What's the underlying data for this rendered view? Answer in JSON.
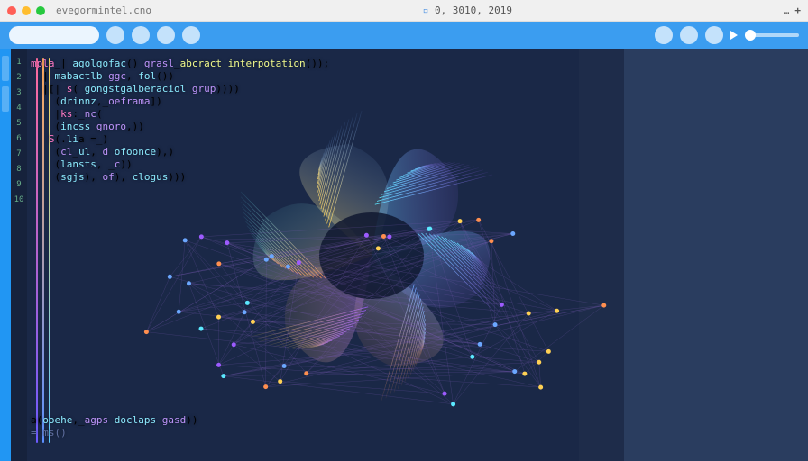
{
  "titlebar": {
    "address_text": "evegormintel.cno",
    "center_text": "0, 3010, 2019",
    "more_label": "…",
    "plus_label": "+"
  },
  "toolbar": {
    "buttons": [
      "menu",
      "search",
      "refresh",
      "settings"
    ],
    "right": [
      "help",
      "history",
      "bookmark",
      "play"
    ]
  },
  "code": {
    "lines": [
      {
        "n": "1",
        "tokens": [
          {
            "c": "kw",
            "t": "mpla"
          },
          {
            "c": "",
            "t": "_| "
          },
          {
            "c": "fn",
            "t": "agolgofac"
          },
          {
            "c": "",
            "t": "() "
          },
          {
            "c": "id",
            "t": "grasl"
          },
          {
            "c": "",
            "t": "_"
          },
          {
            "c": "str",
            "t": "abcract interpotation"
          },
          {
            "c": "",
            "t": "());"
          }
        ]
      },
      {
        "n": "2",
        "tokens": [
          {
            "c": "",
            "t": "  | "
          },
          {
            "c": "fn",
            "t": "mabactlb"
          },
          {
            "c": "",
            "t": " "
          },
          {
            "c": "id",
            "t": "ggc"
          },
          {
            "c": "",
            "t": ", "
          },
          {
            "c": "fn",
            "t": "fol"
          },
          {
            "c": "",
            "t": "())"
          }
        ]
      },
      {
        "n": "3",
        "tokens": [
          {
            "c": "",
            "t": "  |[| "
          },
          {
            "c": "kw",
            "t": "s"
          },
          {
            "c": "",
            "t": "( "
          },
          {
            "c": "fn",
            "t": "gongstgalberaciol"
          },
          {
            "c": "",
            "t": " "
          },
          {
            "c": "id",
            "t": "grup"
          },
          {
            "c": "",
            "t": "))))"
          }
        ]
      },
      {
        "n": "4",
        "tokens": [
          {
            "c": "",
            "t": "    ("
          },
          {
            "c": "fn",
            "t": "drinnz"
          },
          {
            "c": "",
            "t": ",_"
          },
          {
            "c": "id",
            "t": "oeframa"
          },
          {
            "c": "",
            "t": "])"
          }
        ]
      },
      {
        "n": "5",
        "tokens": [
          {
            "c": "",
            "t": "    |"
          },
          {
            "c": "kw",
            "t": "ks"
          },
          {
            "c": "",
            "t": ":_"
          },
          {
            "c": "id",
            "t": "nc"
          },
          {
            "c": "",
            "t": "("
          }
        ]
      },
      {
        "n": "6",
        "tokens": [
          {
            "c": "",
            "t": "    ("
          },
          {
            "c": "fn",
            "t": "incss"
          },
          {
            "c": "",
            "t": " "
          },
          {
            "c": "id",
            "t": "gnoro"
          },
          {
            "c": "",
            "t": ",))"
          }
        ]
      },
      {
        "n": "7",
        "tokens": [
          {
            "c": "",
            "t": "   "
          },
          {
            "c": "kw",
            "t": "S"
          },
          {
            "c": "",
            "t": "(."
          },
          {
            "c": "fn",
            "t": "li"
          },
          {
            "c": "",
            "t": "a =_)"
          }
        ]
      },
      {
        "n": "8",
        "tokens": [
          {
            "c": "",
            "t": "    ("
          },
          {
            "c": "id",
            "t": "cl"
          },
          {
            "c": "",
            "t": "_"
          },
          {
            "c": "fn",
            "t": "ul"
          },
          {
            "c": "",
            "t": ", "
          },
          {
            "c": "id",
            "t": "d"
          },
          {
            "c": "",
            "t": " "
          },
          {
            "c": "fn",
            "t": "ofoonce"
          },
          {
            "c": "",
            "t": "),)"
          }
        ]
      },
      {
        "n": "9",
        "tokens": [
          {
            "c": "",
            "t": "    ("
          },
          {
            "c": "fn",
            "t": "lansts"
          },
          {
            "c": "",
            "t": ", _"
          },
          {
            "c": "id",
            "t": "c"
          },
          {
            "c": "",
            "t": "))"
          }
        ]
      },
      {
        "n": "10",
        "tokens": [
          {
            "c": "",
            "t": "    ("
          },
          {
            "c": "fn",
            "t": "sgjs"
          },
          {
            "c": "",
            "t": "), "
          },
          {
            "c": "id",
            "t": "of"
          },
          {
            "c": "",
            "t": "), "
          },
          {
            "c": "fn",
            "t": "clogus"
          },
          {
            "c": "",
            "t": ")))"
          }
        ]
      },
      {
        "n": "",
        "tokens": [
          {
            "c": "",
            "t": ""
          }
        ]
      },
      {
        "n": "",
        "tokens": [
          {
            "c": "",
            "t": ""
          }
        ]
      },
      {
        "n": "",
        "tokens": [
          {
            "c": "",
            "t": ""
          }
        ]
      }
    ],
    "footer_line": {
      "tokens": [
        {
          "c": "",
          "t": "a("
        },
        {
          "c": "fn",
          "t": "ooehe"
        },
        {
          "c": "",
          "t": ",_"
        },
        {
          "c": "id",
          "t": "agps"
        },
        {
          "c": "",
          "t": " "
        },
        {
          "c": "fn",
          "t": "doclaps"
        },
        {
          "c": "",
          "t": " "
        },
        {
          "c": "id",
          "t": "gasd"
        },
        {
          "c": "",
          "t": "))"
        }
      ]
    },
    "footer_line2": {
      "tokens": [
        {
          "c": "cm",
          "t": "= ms()"
        }
      ]
    }
  },
  "visualization": {
    "type": "parametric-mesh-flower",
    "palette": [
      "#5be9ff",
      "#6ba7ff",
      "#9d5bff",
      "#ff8f4f",
      "#ffd154"
    ],
    "network_nodes": 48
  }
}
